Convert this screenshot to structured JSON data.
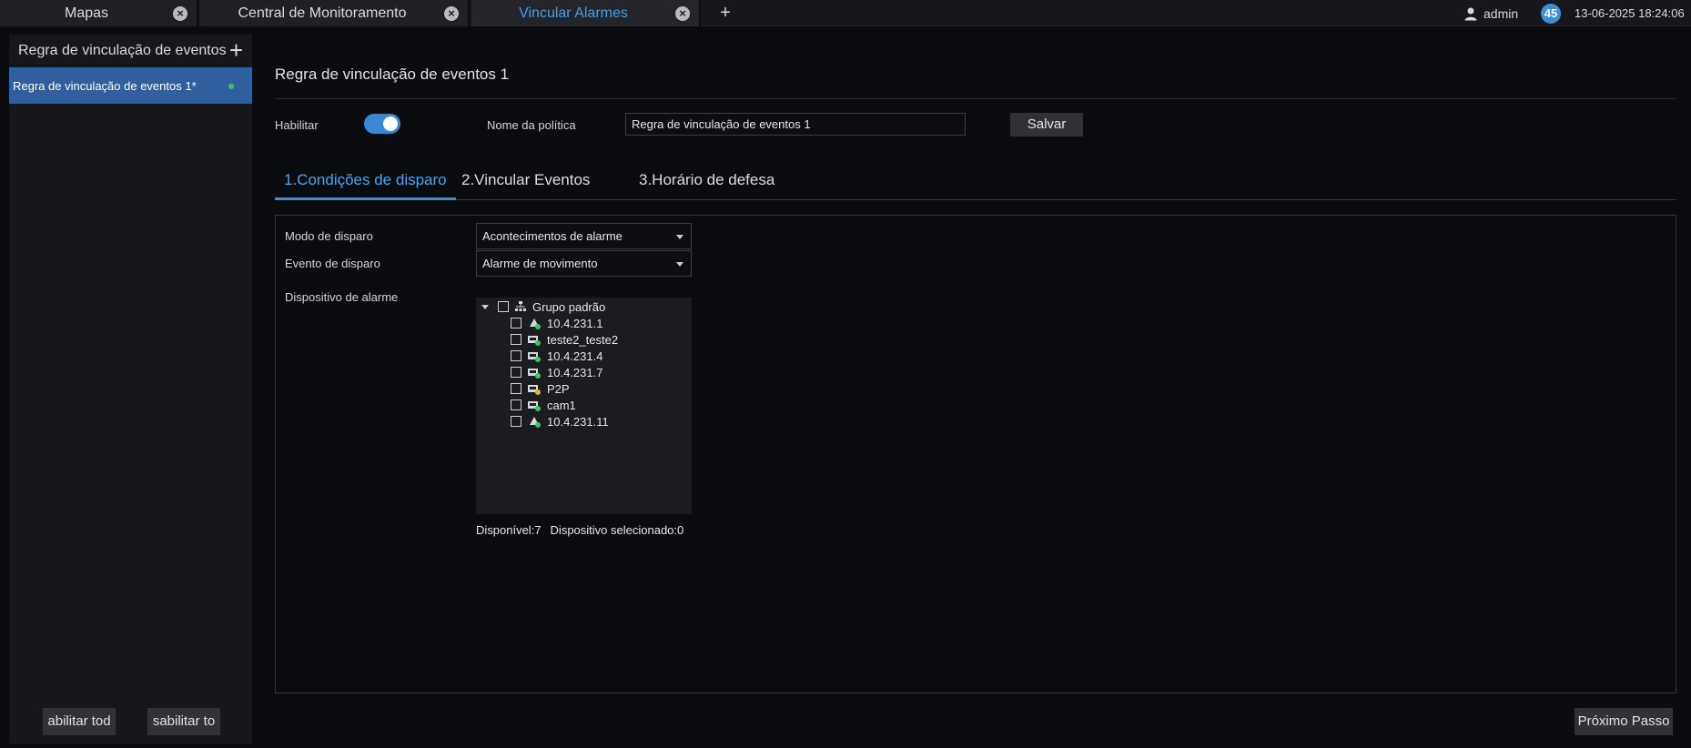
{
  "tabs": [
    {
      "label": "Mapas",
      "active": false
    },
    {
      "label": "Central de Monitoramento",
      "active": false
    },
    {
      "label": "Vincular Alarmes",
      "active": true
    }
  ],
  "header": {
    "username": "admin",
    "notification_count": "45",
    "datetime": "13-06-2025 18:24:06",
    "add_tab_symbol": "+",
    "close_symbol": "×"
  },
  "sidebar": {
    "title": "Regra de vinculação de eventos",
    "add_symbol": "+",
    "rules": [
      {
        "label": "Regra de vinculação de eventos 1*",
        "status_color": "#3fc45c"
      }
    ],
    "enable_all_label": "abilitar tod",
    "disable_all_label": "sabilitar to\u0000"
  },
  "main": {
    "title": "Regra de vinculação de eventos 1",
    "enable_label": "Habilitar",
    "enabled": true,
    "policy_name_label": "Nome da política",
    "policy_name_value": "Regra de vinculação de eventos 1",
    "save_label": "Salvar",
    "steps": [
      {
        "label": "1.Condições de disparo",
        "active": true
      },
      {
        "label": "2.Vincular Eventos",
        "active": false
      },
      {
        "label": "3.Horário de defesa",
        "active": false
      }
    ],
    "trigger_mode_label": "Modo de disparo",
    "trigger_mode_value": "Acontecimentos de alarme",
    "trigger_event_label": "Evento de disparo",
    "trigger_event_value": "Alarme de movimento",
    "alarm_device_label": "Dispositivo de alarme",
    "tree": {
      "group_label": "Grupo padrão",
      "devices": [
        {
          "label": "10.4.231.1",
          "icon": "dome-camera-icon"
        },
        {
          "label": "teste2_teste2",
          "icon": "nvr-icon"
        },
        {
          "label": "10.4.231.4",
          "icon": "nvr-icon"
        },
        {
          "label": "10.4.231.7",
          "icon": "nvr-icon"
        },
        {
          "label": "P2P",
          "icon": "p2p-device-icon"
        },
        {
          "label": "cam1",
          "icon": "nvr-icon"
        },
        {
          "label": "10.4.231.11",
          "icon": "dome-camera-icon"
        }
      ]
    },
    "available_text": "Disponível:7",
    "selected_text": "Dispositivo selecionado:0",
    "next_label": "Próximo Passo"
  },
  "colors": {
    "accent": "#3a8fd9",
    "selected_rule_bg": "#2f5f9e",
    "online_green": "#3fc45c"
  }
}
